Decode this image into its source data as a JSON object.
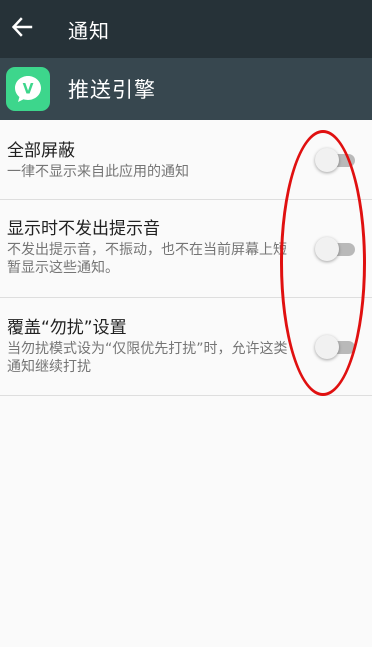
{
  "toolbar": {
    "title": "通知",
    "back_icon": "arrow-left-icon"
  },
  "app": {
    "name": "推送引擎",
    "icon": "app-v-logo-icon",
    "icon_letter": "V",
    "icon_color": "#3dd68c"
  },
  "settings": [
    {
      "title": "全部屏蔽",
      "summary": "一律不显示来自此应用的通知",
      "enabled": false
    },
    {
      "title": "显示时不发出提示音",
      "summary": "不发出提示音，不振动，也不在当前屏幕上短暂显示这些通知。",
      "enabled": false
    },
    {
      "title": "覆盖“勿扰”设置",
      "summary": "当勿扰模式设为“仅限优先打扰”时，允许这类通知继续打扰",
      "enabled": false
    }
  ],
  "colors": {
    "toolbar_bg": "#263238",
    "app_header_bg": "#37474f",
    "annotation": "#e01010"
  }
}
